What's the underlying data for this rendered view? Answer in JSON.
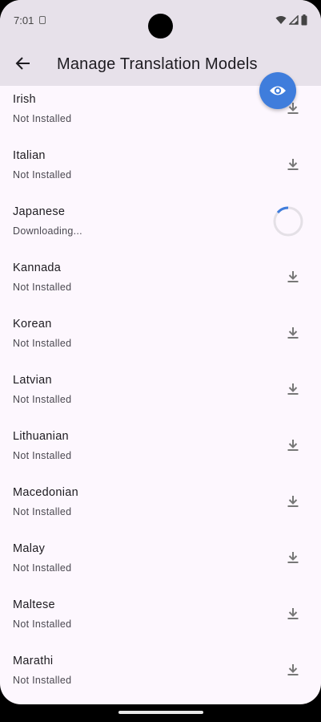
{
  "status_bar": {
    "time": "7:01"
  },
  "app_bar": {
    "title": "Manage Translation Models"
  },
  "colors": {
    "accent": "#3f7ddc",
    "app_bar_bg": "#e7e1ea",
    "page_bg": "#fdf7fe"
  },
  "languages": [
    {
      "name": "Irish",
      "status": "Not Installed",
      "action_icon": "download-icon"
    },
    {
      "name": "Italian",
      "status": "Not Installed",
      "action_icon": "download-icon"
    },
    {
      "name": "Japanese",
      "status": "Downloading...",
      "action_icon": "progress-spinner"
    },
    {
      "name": "Kannada",
      "status": "Not Installed",
      "action_icon": "download-icon"
    },
    {
      "name": "Korean",
      "status": "Not Installed",
      "action_icon": "download-icon"
    },
    {
      "name": "Latvian",
      "status": "Not Installed",
      "action_icon": "download-icon"
    },
    {
      "name": "Lithuanian",
      "status": "Not Installed",
      "action_icon": "download-icon"
    },
    {
      "name": "Macedonian",
      "status": "Not Installed",
      "action_icon": "download-icon"
    },
    {
      "name": "Malay",
      "status": "Not Installed",
      "action_icon": "download-icon"
    },
    {
      "name": "Maltese",
      "status": "Not Installed",
      "action_icon": "download-icon"
    },
    {
      "name": "Marathi",
      "status": "Not Installed",
      "action_icon": "download-icon"
    }
  ]
}
